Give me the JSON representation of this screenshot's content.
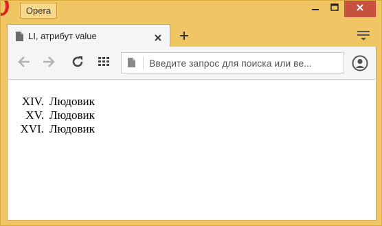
{
  "titlebar": {
    "menu_label": "Opera"
  },
  "tab": {
    "title": "LI, атрибут value"
  },
  "toolbar": {
    "address_placeholder": "Введите запрос для поиска или ве..."
  },
  "content": {
    "items": [
      {
        "marker": "XIV.",
        "text": "Людовик"
      },
      {
        "marker": "XV.",
        "text": "Людовик"
      },
      {
        "marker": "XVI.",
        "text": "Людовик"
      }
    ]
  },
  "colors": {
    "frame": "#f0c564",
    "close_button": "#c7503f",
    "opera_red": "#e0221f"
  }
}
